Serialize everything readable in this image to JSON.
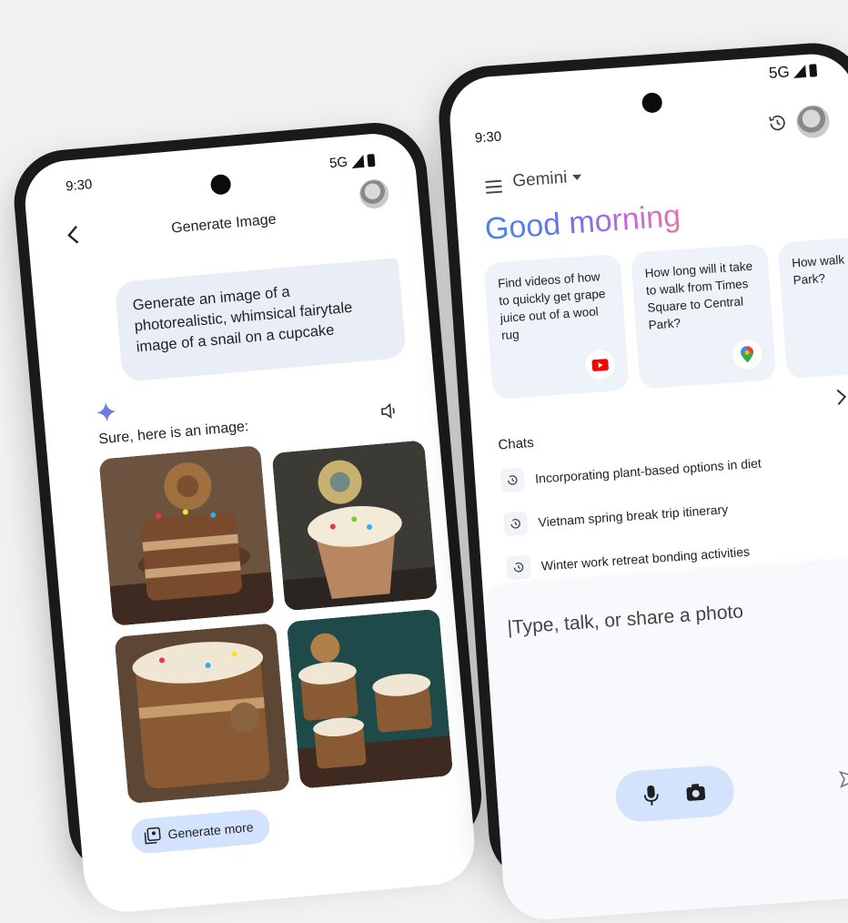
{
  "left_phone": {
    "status_time": "9:30",
    "network": "5G",
    "header_title": "Generate Image",
    "user_prompt": "Generate an image of a photorealistic, whimsical fairytale image of a snail on a cupcake",
    "response_text": "Sure, here is an image:",
    "generate_more_label": "Generate more",
    "icons": [
      "back-arrow-icon",
      "signal-icon",
      "battery-icon",
      "avatar",
      "sparkle-icon",
      "speaker-icon",
      "generate-image-icon"
    ]
  },
  "right_phone": {
    "status_time": "9:30",
    "network": "5G",
    "app_name": "Gemini",
    "greeting": "Good morning",
    "suggestions": [
      {
        "text": "Find videos of how to quickly get grape juice out of a wool rug",
        "icon": "youtube-icon"
      },
      {
        "text": "How long will it take to walk from Times Square to Central Park?",
        "icon": "maps-pin-icon"
      },
      {
        "text": "How walk Squa Park?",
        "icon": ""
      }
    ],
    "chats_label": "Chats",
    "chats": [
      "Incorporating plant-based options in diet",
      "Vietnam spring break trip itinerary",
      "Winter work retreat bonding activities"
    ],
    "composer_placeholder": "|Type, talk, or share a photo",
    "colors": {
      "greeting_start": "#4285f4",
      "greeting_end": "#e7769f",
      "pill": "#d3e3fd",
      "youtube_red": "#ff0000"
    }
  }
}
